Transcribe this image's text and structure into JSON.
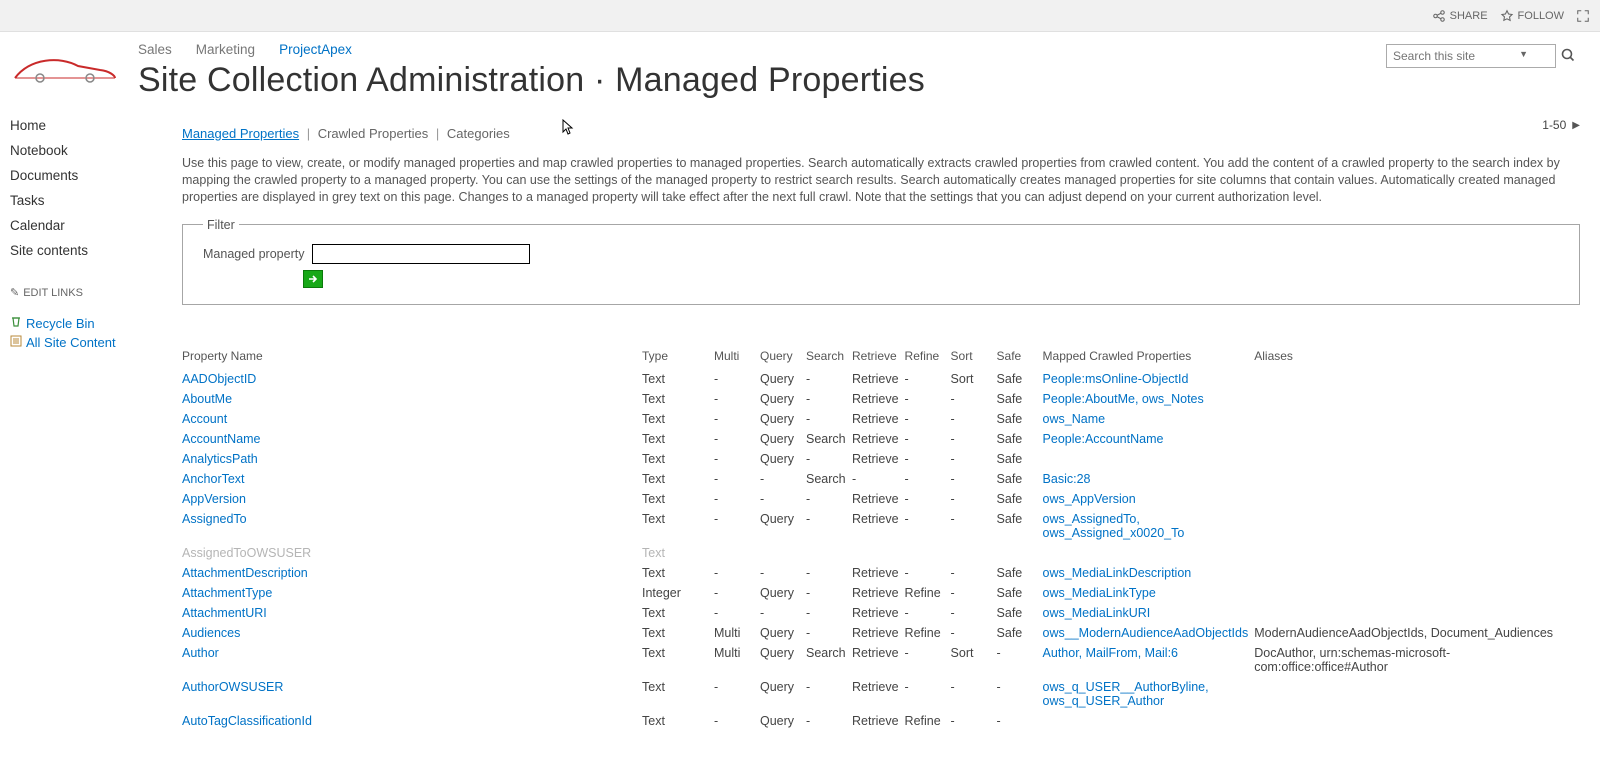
{
  "ribbon": {
    "share": "SHARE",
    "follow": "FOLLOW"
  },
  "top_tabs": [
    "Sales",
    "Marketing",
    "ProjectApex"
  ],
  "top_tabs_active": 2,
  "page_title": "Site Collection Administration · Managed Properties",
  "search": {
    "placeholder": "Search this site"
  },
  "left_nav": [
    "Home",
    "Notebook",
    "Documents",
    "Tasks",
    "Calendar",
    "Site contents"
  ],
  "left_nav_edit": "EDIT LINKS",
  "admin_links": [
    {
      "icon": "recycle",
      "label": "Recycle Bin"
    },
    {
      "icon": "list",
      "label": "All Site Content"
    }
  ],
  "sub_tabs": {
    "active": "Managed Properties",
    "others": [
      "Crawled Properties",
      "Categories"
    ]
  },
  "pager": "1-50",
  "intro": "Use this page to view, create, or modify managed properties and map crawled properties to managed properties. Search automatically extracts crawled properties from crawled content. You add the content of a crawled property to the search index by mapping the crawled property to a managed property. You can use the settings of the managed property to restrict search results. Search automatically creates managed properties for site columns that contain values. Automatically created managed properties are displayed in grey text on this page. Changes to a managed property will take effect after the next full crawl. Note that the settings that you can adjust depend on your current authorization level.",
  "filter": {
    "legend": "Filter",
    "label": "Managed property"
  },
  "columns": [
    "Property Name",
    "Type",
    "Multi",
    "Query",
    "Search",
    "Retrieve",
    "Refine",
    "Sort",
    "Safe",
    "Mapped Crawled Properties",
    "Aliases"
  ],
  "rows": [
    {
      "name": "AADObjectID",
      "type": "Text",
      "multi": "-",
      "query": "Query",
      "search": "-",
      "retrieve": "Retrieve",
      "refine": "-",
      "sort": "Sort",
      "safe": "Safe",
      "mapped": "People:msOnline-ObjectId",
      "aliases": ""
    },
    {
      "name": "AboutMe",
      "type": "Text",
      "multi": "-",
      "query": "Query",
      "search": "-",
      "retrieve": "Retrieve",
      "refine": "-",
      "sort": "-",
      "safe": "Safe",
      "mapped": "People:AboutMe, ows_Notes",
      "aliases": ""
    },
    {
      "name": "Account",
      "type": "Text",
      "multi": "-",
      "query": "Query",
      "search": "-",
      "retrieve": "Retrieve",
      "refine": "-",
      "sort": "-",
      "safe": "Safe",
      "mapped": "ows_Name",
      "aliases": ""
    },
    {
      "name": "AccountName",
      "type": "Text",
      "multi": "-",
      "query": "Query",
      "search": "Search",
      "retrieve": "Retrieve",
      "refine": "-",
      "sort": "-",
      "safe": "Safe",
      "mapped": "People:AccountName",
      "aliases": ""
    },
    {
      "name": "AnalyticsPath",
      "type": "Text",
      "multi": "-",
      "query": "Query",
      "search": "-",
      "retrieve": "Retrieve",
      "refine": "-",
      "sort": "-",
      "safe": "Safe",
      "mapped": "",
      "aliases": ""
    },
    {
      "name": "AnchorText",
      "type": "Text",
      "multi": "-",
      "query": "-",
      "search": "Search",
      "retrieve": "-",
      "refine": "-",
      "sort": "-",
      "safe": "Safe",
      "mapped": "Basic:28",
      "aliases": ""
    },
    {
      "name": "AppVersion",
      "type": "Text",
      "multi": "-",
      "query": "-",
      "search": "-",
      "retrieve": "Retrieve",
      "refine": "-",
      "sort": "-",
      "safe": "Safe",
      "mapped": "ows_AppVersion",
      "aliases": ""
    },
    {
      "name": "AssignedTo",
      "type": "Text",
      "multi": "-",
      "query": "Query",
      "search": "-",
      "retrieve": "Retrieve",
      "refine": "-",
      "sort": "-",
      "safe": "Safe",
      "mapped": "ows_AssignedTo, ows_Assigned_x0020_To",
      "aliases": ""
    },
    {
      "auto": true,
      "name": "AssignedToOWSUSER",
      "type": "Text",
      "multi": "",
      "query": "",
      "search": "",
      "retrieve": "",
      "refine": "",
      "sort": "",
      "safe": "",
      "mapped": "",
      "aliases": ""
    },
    {
      "name": "AttachmentDescription",
      "type": "Text",
      "multi": "-",
      "query": "-",
      "search": "-",
      "retrieve": "Retrieve",
      "refine": "-",
      "sort": "-",
      "safe": "Safe",
      "mapped": "ows_MediaLinkDescription",
      "aliases": ""
    },
    {
      "name": "AttachmentType",
      "type": "Integer",
      "multi": "-",
      "query": "Query",
      "search": "-",
      "retrieve": "Retrieve",
      "refine": "Refine",
      "sort": "-",
      "safe": "Safe",
      "mapped": "ows_MediaLinkType",
      "aliases": ""
    },
    {
      "name": "AttachmentURI",
      "type": "Text",
      "multi": "-",
      "query": "-",
      "search": "-",
      "retrieve": "Retrieve",
      "refine": "-",
      "sort": "-",
      "safe": "Safe",
      "mapped": "ows_MediaLinkURI",
      "aliases": ""
    },
    {
      "name": "Audiences",
      "type": "Text",
      "multi": "Multi",
      "query": "Query",
      "search": "-",
      "retrieve": "Retrieve",
      "refine": "Refine",
      "sort": "-",
      "safe": "Safe",
      "mapped": "ows__ModernAudienceAadObjectIds",
      "aliases": "ModernAudienceAadObjectIds, Document_Audiences"
    },
    {
      "name": "Author",
      "type": "Text",
      "multi": "Multi",
      "query": "Query",
      "search": "Search",
      "retrieve": "Retrieve",
      "refine": "-",
      "sort": "Sort",
      "safe": "-",
      "mapped": "Author, MailFrom, Mail:6",
      "aliases": "DocAuthor, urn:schemas-microsoft-com:office:office#Author"
    },
    {
      "name": "AuthorOWSUSER",
      "type": "Text",
      "multi": "-",
      "query": "Query",
      "search": "-",
      "retrieve": "Retrieve",
      "refine": "-",
      "sort": "-",
      "safe": "-",
      "mapped": "ows_q_USER__AuthorByline, ows_q_USER_Author",
      "aliases": ""
    },
    {
      "name": "AutoTagClassificationId",
      "type": "Text",
      "multi": "-",
      "query": "Query",
      "search": "-",
      "retrieve": "Retrieve",
      "refine": "Refine",
      "sort": "-",
      "safe": "-",
      "mapped": "",
      "aliases": ""
    }
  ]
}
